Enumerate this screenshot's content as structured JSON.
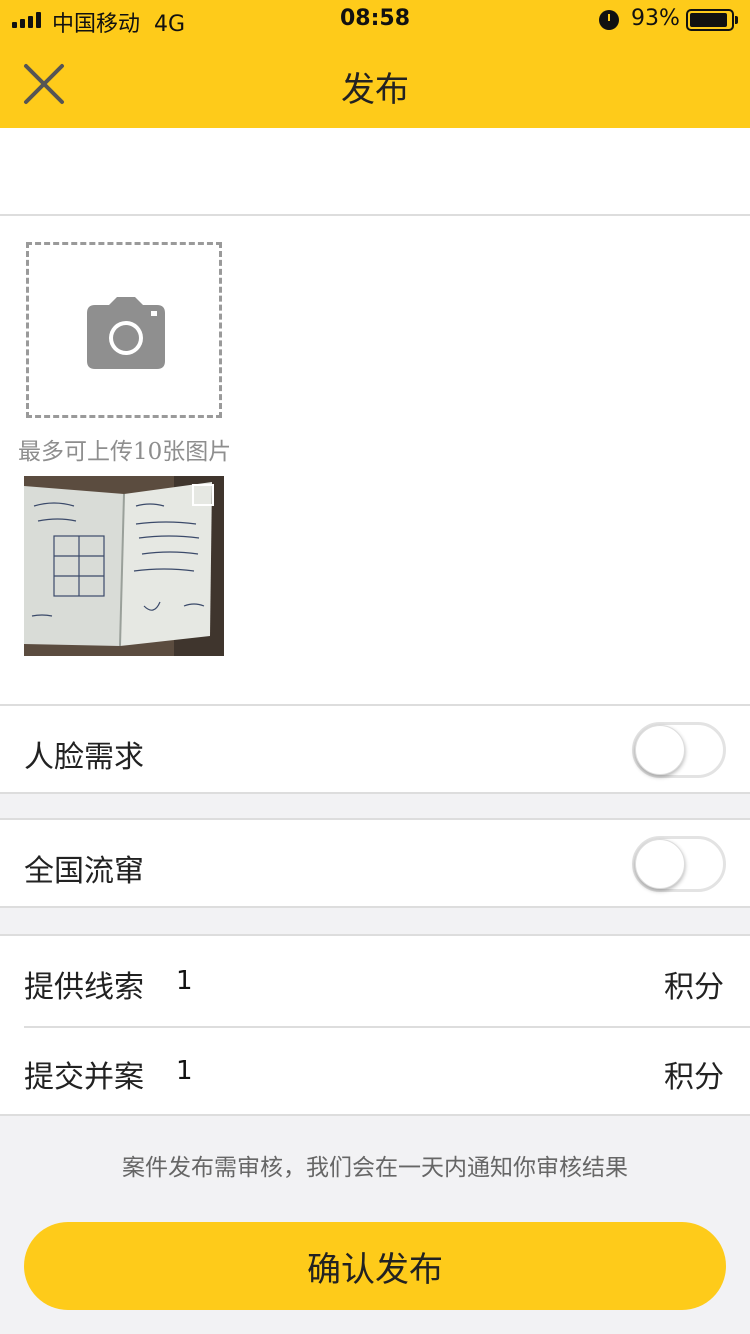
{
  "status_bar": {
    "carrier": "中国移动",
    "network": "4G",
    "time": "08:58",
    "battery": "93%"
  },
  "nav": {
    "title": "发布",
    "close_icon": "close-icon"
  },
  "title_input": {
    "value": "",
    "placeholder": ""
  },
  "upload": {
    "icon": "camera-icon",
    "hint": "最多可上传10张图片",
    "images": [
      {
        "name": "notebook-photo",
        "selected": false
      }
    ]
  },
  "toggles": [
    {
      "label": "人脸需求",
      "on": false
    },
    {
      "label": "全国流窜",
      "on": false
    }
  ],
  "points": [
    {
      "label": "提供线索",
      "value": "1",
      "unit": "积分"
    },
    {
      "label": "提交并案",
      "value": "1",
      "unit": "积分"
    }
  ],
  "review_note": "案件发布需审核，我们会在一天内通知你审核结果",
  "confirm_label": "确认发布",
  "colors": {
    "accent": "#fecb1a",
    "background": "#f2f2f4",
    "hint_text": "#8e8e8e"
  }
}
